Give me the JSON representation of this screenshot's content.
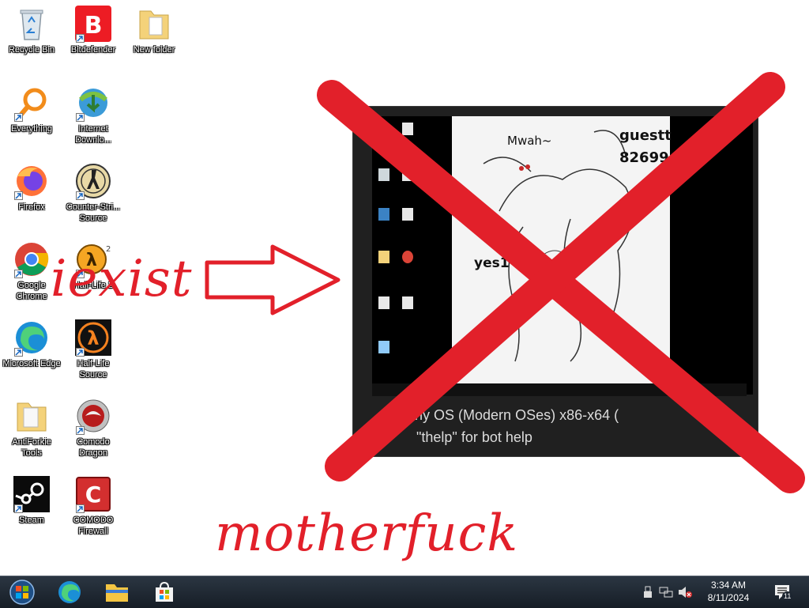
{
  "desktop": {
    "icons": [
      {
        "label": "Recycle Bin"
      },
      {
        "label": "Bitdefender"
      },
      {
        "label": "New folder"
      },
      {
        "label": "Everything"
      },
      {
        "label": "Internet Downlo..."
      },
      {
        "label": "Firefox"
      },
      {
        "label": "Counter-Stri... Source"
      },
      {
        "label": "Google Chrome"
      },
      {
        "label": "Half-Life 2"
      },
      {
        "label": "Microsoft Edge"
      },
      {
        "label": "Half-Life Source"
      },
      {
        "label": "AntiForkie Tools"
      },
      {
        "label": "Comodo Dragon"
      },
      {
        "label": "Steam"
      },
      {
        "label": "COMODO Firewall"
      }
    ]
  },
  "annotations": {
    "word_left": "iexist",
    "word_bottom": "motherfuck",
    "color": "#e2202a"
  },
  "embedded_screenshot": {
    "art_text_1": "Mwah~",
    "art_text_2": "guestt",
    "art_text_3": "82699",
    "art_text_4": "yes1",
    "caption_line1": "I... Any OS (Modern OSes) x86-x64 (",
    "caption_line2": "\"thelp\" for bot help"
  },
  "taskbar": {
    "time": "3:34 AM",
    "date": "8/11/2024",
    "notification_count": "11",
    "pinned": [
      "start-orb-icon",
      "edge-icon",
      "file-explorer-icon",
      "microsoft-store-icon"
    ]
  }
}
